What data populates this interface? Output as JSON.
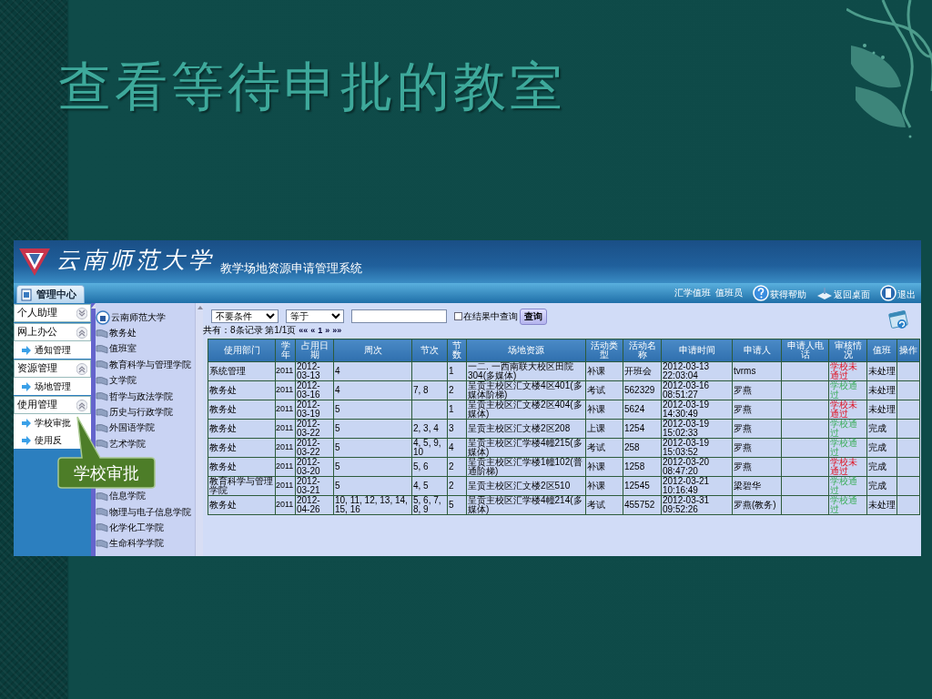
{
  "slide": {
    "title": "查看等待申批的教室"
  },
  "app": {
    "brand": "云南师范大学",
    "system_name": "教学场地资源申请管理系统",
    "tab": "管理中心",
    "user": {
      "unit": "汇学值班",
      "role": "值班员"
    },
    "toolbar": [
      {
        "kind": "help",
        "label": "获得帮助"
      },
      {
        "kind": "desktop",
        "label": "返回桌面"
      },
      {
        "kind": "exit",
        "label": "退出"
      }
    ],
    "nav": [
      {
        "label": "个人助理",
        "expanded": false
      },
      {
        "label": "网上办公",
        "expanded": true,
        "children": [
          "通知管理"
        ]
      },
      {
        "label": "资源管理",
        "expanded": true,
        "children": [
          "场地管理"
        ]
      },
      {
        "label": "使用管理",
        "expanded": true,
        "children": [
          "学校审批",
          "使用反"
        ]
      }
    ],
    "tree": {
      "root": "云南师范大学",
      "items": [
        "教务处",
        "值班室",
        "教育科学与管理学院",
        "文学院",
        "哲学与政法学院",
        "历史与行政学院",
        "外国语学院",
        "艺术学院"
      ],
      "items_below_callout": [
        "信息学院",
        "物理与电子信息学院",
        "化学化工学院",
        "生命科学学院"
      ]
    },
    "callout": "学校审批",
    "filter": {
      "condition": "不要条件",
      "operator": "等于",
      "within_results": {
        "label": "在结果中查询",
        "checked": false
      },
      "button": "查询"
    },
    "pager": {
      "summary": "共有：8条记录 第1/1页",
      "links": [
        "««",
        "«",
        "1",
        "»",
        "»»"
      ]
    },
    "table": {
      "columns": [
        "使用部门",
        "学年",
        "占用日期",
        "周次",
        "节次",
        "节数",
        "场地资源",
        "活动类型",
        "活动名称",
        "申请时间",
        "申请人",
        "申请人电话",
        "审核情况",
        "值班",
        "操作"
      ],
      "rows": [
        {
          "dept": "系统管理",
          "year": "2011",
          "date": "2012-03-13",
          "weeks": "4",
          "count": "1",
          "venue": "一二. 一西南联大校区田院304(多媒体)",
          "type": "补课",
          "name": "开班会",
          "time": "2012-03-13 22:03:04",
          "applicant": "tvrms",
          "review": {
            "text": "学校未通过",
            "passed": false
          },
          "duty": "未处理"
        },
        {
          "dept": "教务处",
          "year": "2011",
          "date": "2012-03-16",
          "weeks": "4",
          "sections": "7, 8",
          "count": "2",
          "venue": "呈贡主校区汇文楼4区401(多媒体阶梯)",
          "type": "考试",
          "name": "562329",
          "time": "2012-03-16 08:51:27",
          "applicant": "罗燕",
          "review": {
            "text": "学校通过",
            "passed": true
          },
          "duty": "未处理"
        },
        {
          "dept": "教务处",
          "year": "2011",
          "date": "2012-03-19",
          "weeks": "5",
          "count": "1",
          "venue": "呈贡主校区汇文楼2区404(多媒体)",
          "type": "补课",
          "name": "5624",
          "time": "2012-03-19 14:30:49",
          "applicant": "罗燕",
          "review": {
            "text": "学校未通过",
            "passed": false
          },
          "duty": "未处理"
        },
        {
          "dept": "教务处",
          "year": "2011",
          "date": "2012-03-22",
          "weeks": "5",
          "sections": "2, 3, 4",
          "count": "3",
          "venue": "呈贡主校区汇文楼2区208",
          "type": "上课",
          "name": "1254",
          "time": "2012-03-19 15:02:33",
          "applicant": "罗燕",
          "review": {
            "text": "学校通过",
            "passed": true
          },
          "duty": "完成"
        },
        {
          "dept": "教务处",
          "year": "2011",
          "date": "2012-03-22",
          "weeks": "5",
          "sections": "4, 5, 9, 10",
          "count": "4",
          "venue": "呈贡主校区汇学楼4幢215(多媒体)",
          "type": "考试",
          "name": "258",
          "time": "2012-03-19 15:03:52",
          "applicant": "罗燕",
          "review": {
            "text": "学校通过",
            "passed": true
          },
          "duty": "完成"
        },
        {
          "dept": "教务处",
          "year": "2011",
          "date": "2012-03-20",
          "weeks": "5",
          "sections": "5, 6",
          "count": "2",
          "venue": "呈贡主校区汇学楼1幢102(普通阶梯)",
          "type": "补课",
          "name": "1258",
          "time": "2012-03-20 08:47:20",
          "applicant": "罗燕",
          "review": {
            "text": "学校未通过",
            "passed": false
          },
          "duty": "完成"
        },
        {
          "dept": "教育科学与管理学院",
          "year": "2011",
          "date": "2012-03-21",
          "weeks": "5",
          "sections": "4, 5",
          "count": "2",
          "venue": "呈贡主校区汇文楼2区510",
          "type": "补课",
          "name": "12545",
          "time": "2012-03-21 10:16:49",
          "applicant": "梁碧华",
          "review": {
            "text": "学校通过",
            "passed": true
          },
          "duty": "完成"
        },
        {
          "dept": "教务处",
          "year": "2011",
          "date": "2012-04-26",
          "weeks": "10, 11, 12, 13, 14, 15, 16",
          "sections": "5, 6, 7, 8, 9",
          "count": "5",
          "venue": "呈贡主校区汇学楼4幢214(多媒体)",
          "type": "考试",
          "name": "455752",
          "time": "2012-03-31 09:52:26",
          "applicant": "罗燕(教务)",
          "review": {
            "text": "学校通过",
            "passed": true
          },
          "duty": "未处理"
        }
      ]
    }
  }
}
